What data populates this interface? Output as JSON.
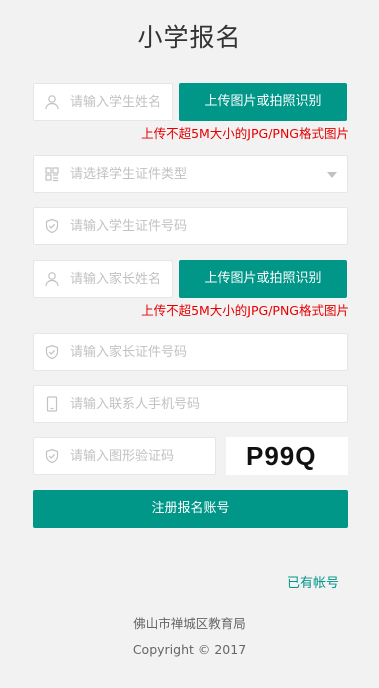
{
  "header": {
    "title": "小学报名"
  },
  "form": {
    "student_name": {
      "placeholder": "请输入学生姓名"
    },
    "student_upload_button": "上传图片或拍照识别",
    "student_upload_hint": "上传不超5M大小的JPG/PNG格式图片",
    "student_id_type": {
      "placeholder": "请选择学生证件类型"
    },
    "student_id_number": {
      "placeholder": "请输入学生证件号码"
    },
    "parent_name": {
      "placeholder": "请输入家长姓名"
    },
    "parent_upload_button": "上传图片或拍照识别",
    "parent_upload_hint": "上传不超5M大小的JPG/PNG格式图片",
    "parent_id_number": {
      "placeholder": "请输入家长证件号码"
    },
    "contact_phone": {
      "placeholder": "请输入联系人手机号码"
    },
    "captcha_input": {
      "placeholder": "请输入图形验证码"
    },
    "captcha_image_text": "P99Q",
    "register_button": "注册报名账号"
  },
  "links": {
    "have_account": "已有帐号"
  },
  "footer": {
    "org": "佛山市禅城区教育局",
    "copyright": "Copyright © 2017"
  },
  "colors": {
    "accent": "#009688",
    "warning": "#e60000",
    "background": "#f2f2f2"
  },
  "icons": [
    "user-icon",
    "grid-icon",
    "shield-icon",
    "phone-icon",
    "chevron-down-icon"
  ]
}
